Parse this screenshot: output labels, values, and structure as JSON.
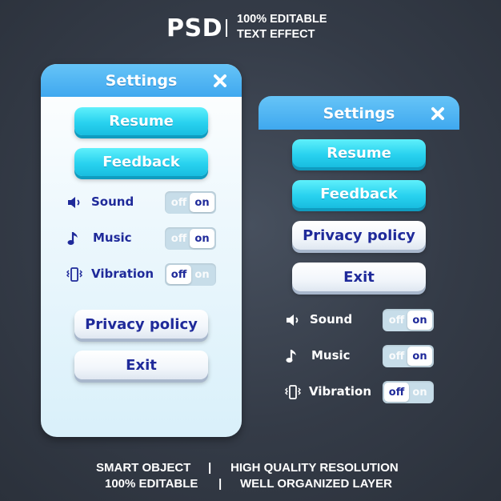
{
  "header": {
    "psd": "PSD",
    "line1": "100% EDITABLE",
    "line2": "TEXT EFFECT"
  },
  "left_panel": {
    "title": "Settings",
    "close_icon": "close-icon",
    "buttons": {
      "resume": "Resume",
      "feedback": "Feedback",
      "privacy": "Privacy policy",
      "exit": "Exit"
    },
    "settings": [
      {
        "label": "Sound",
        "icon": "speaker-icon",
        "off": "off",
        "on": "on",
        "state": "on"
      },
      {
        "label": "Music",
        "icon": "music-note-icon",
        "off": "off",
        "on": "on",
        "state": "on"
      },
      {
        "label": "Vibration",
        "icon": "vibration-icon",
        "off": "off",
        "on": "on",
        "state": "off"
      }
    ]
  },
  "right_panel": {
    "title": "Settings",
    "close_icon": "close-icon",
    "buttons": {
      "resume": "Resume",
      "feedback": "Feedback",
      "privacy": "Privacy policy",
      "exit": "Exit"
    },
    "settings": [
      {
        "label": "Sound",
        "icon": "speaker-icon",
        "off": "off",
        "on": "on",
        "state": "on"
      },
      {
        "label": "Music",
        "icon": "music-note-icon",
        "off": "off",
        "on": "on",
        "state": "on"
      },
      {
        "label": "Vibration",
        "icon": "vibration-icon",
        "off": "off",
        "on": "on",
        "state": "off"
      }
    ]
  },
  "footer": {
    "left_top": "SMART OBJECT",
    "left_bottom": "100% EDITABLE",
    "sep": "|",
    "right_top": "HIGH QUALITY RESOLUTION",
    "right_bottom": "WELL ORGANIZED LAYER"
  },
  "colors": {
    "background": "#343b47",
    "header_bar": "#3fa8ef",
    "cyan_button": "#29d2ef",
    "label_text": "#1f2a9a",
    "toggle_track": "#c7dde9"
  }
}
